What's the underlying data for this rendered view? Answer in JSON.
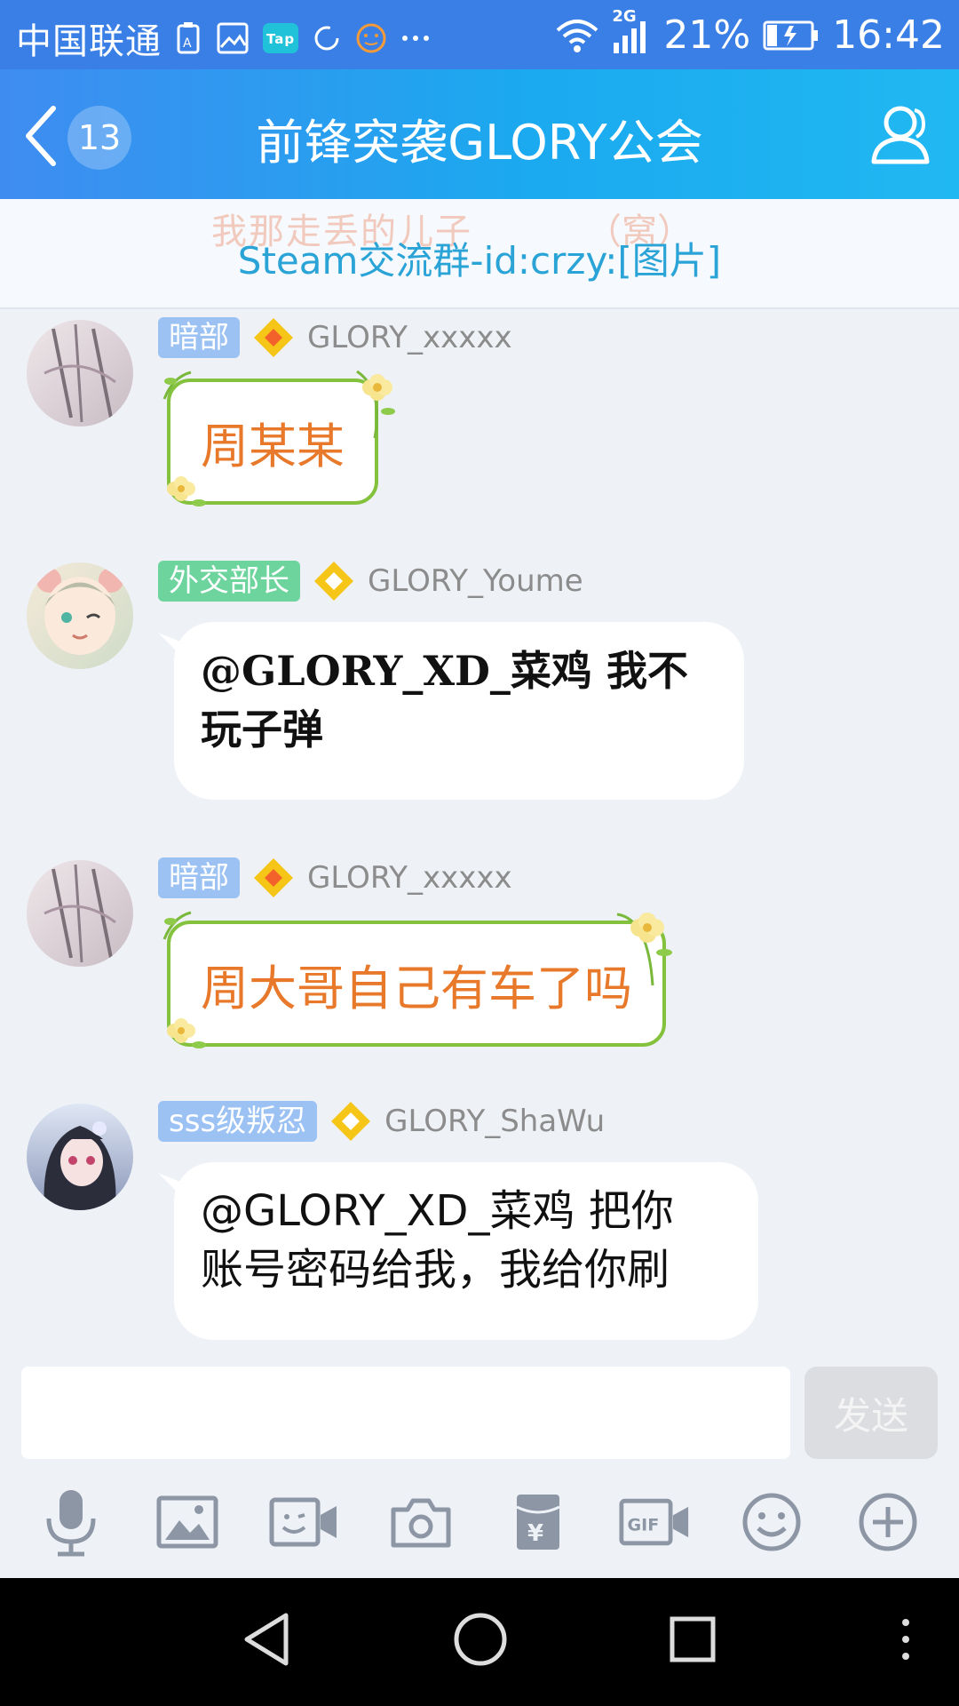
{
  "status_bar": {
    "carrier": "中国联通",
    "network": "2G",
    "battery_percent": "21%",
    "time": "16:42",
    "icons": [
      "sim-icon",
      "gallery-icon",
      "tap-icon",
      "loading-icon",
      "emoji-notify-icon",
      "more-dots-icon",
      "wifi-icon",
      "signal-icon",
      "battery-icon"
    ]
  },
  "header": {
    "back_badge_count": "13",
    "title": "前锋突袭GLORY公会",
    "members_icon": "members-icon"
  },
  "notice": {
    "ghost_text": "我那走丢的儿子",
    "ghost_text2": "（窝）",
    "text": "Steam交流群-id:crzy:[图片]"
  },
  "messages": [
    {
      "tag": "暗部",
      "tag_color": "#9cc2f4",
      "name": "GLORY_xxxxx",
      "text": "周某某",
      "style": "green-bubble"
    },
    {
      "tag": "外交部长",
      "tag_color": "#6ed49e",
      "name": "GLORY_Youme",
      "text_line1": "@GLORY_XD_菜鸡 我不",
      "text_line2": "玩子弹",
      "style": "white-bubble"
    },
    {
      "tag": "暗部",
      "tag_color": "#9cc2f4",
      "name": "GLORY_xxxxx",
      "text": "周大哥自己有车了吗",
      "style": "green-bubble"
    },
    {
      "tag": "sss级叛忍",
      "tag_color": "#9cc2f4",
      "name": "GLORY_ShaWu",
      "text_line1": "@GLORY_XD_菜鸡 把你",
      "text_line2": "账号密码给我，我给你刷",
      "style": "white-bubble"
    }
  ],
  "input": {
    "placeholder": "",
    "send_label": "发送"
  },
  "toolbar": {
    "items": [
      "mic-icon",
      "image-icon",
      "video-chat-icon",
      "camera-icon",
      "red-packet-icon",
      "gif-icon",
      "emoji-icon",
      "plus-icon"
    ]
  },
  "colors": {
    "header_start": "#3f8cf0",
    "header_end": "#20b8f2",
    "accent_orange": "#e8792a",
    "bubble_border_green": "#84c23d",
    "notice_text": "#2aa3d6"
  }
}
